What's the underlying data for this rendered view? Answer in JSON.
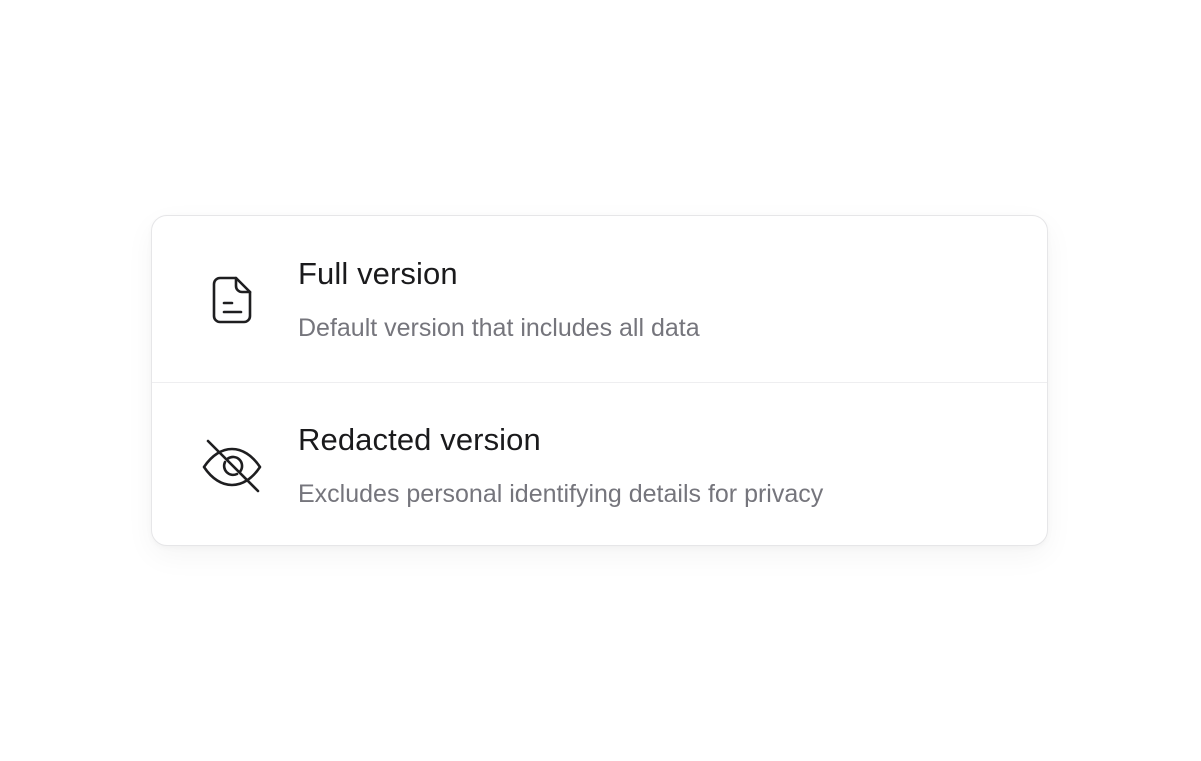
{
  "options": [
    {
      "icon": "document-icon",
      "title": "Full version",
      "description": "Default version that includes all data"
    },
    {
      "icon": "eye-off-icon",
      "title": "Redacted version",
      "description": "Excludes personal identifying details for privacy"
    }
  ],
  "colors": {
    "title": "#1a1a1c",
    "description": "#75757c",
    "border": "#e6e6e8",
    "icon_stroke": "#1e1e20"
  }
}
